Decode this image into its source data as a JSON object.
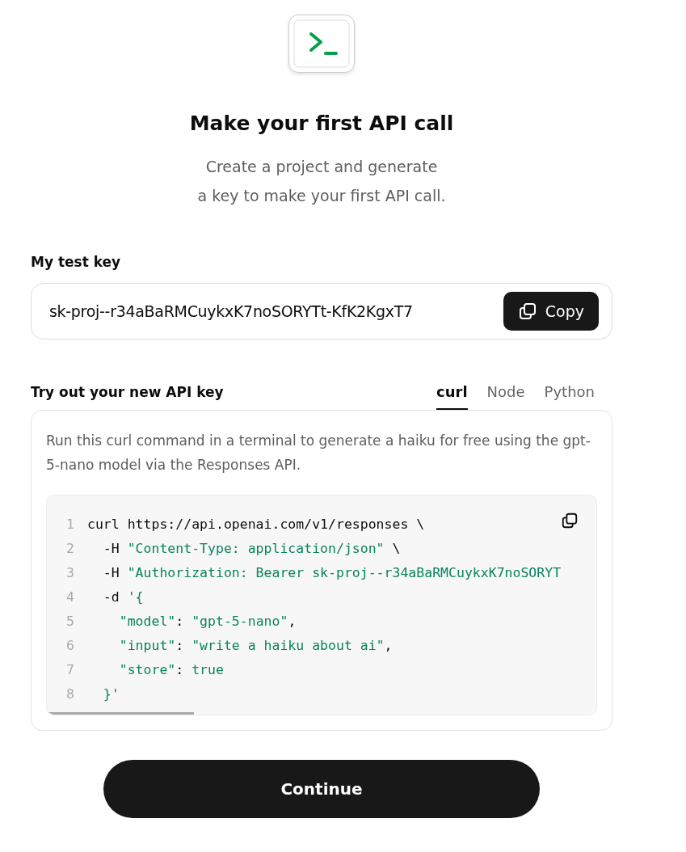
{
  "header": {
    "title": "Make your first API call",
    "subtitle_lines": [
      "Create a project and generate",
      "a key to make your first API call."
    ]
  },
  "key": {
    "label": "My test key",
    "value": "sk-proj--r34aBaRMCuykxK7noSORYTt-KfK2KgxT7",
    "copy_label": "Copy"
  },
  "try": {
    "label": "Try out your new API key",
    "tabs": [
      {
        "label": "curl",
        "selected": true
      },
      {
        "label": "Node",
        "selected": false
      },
      {
        "label": "Python",
        "selected": false
      }
    ],
    "description": "Run this curl command in a terminal to generate a haiku for free using the gpt-5-nano model via the Responses API.",
    "code": [
      {
        "number": "1",
        "tokens": [
          {
            "kind": "plain",
            "text": "curl https://api.openai.com/v1/responses \\"
          }
        ]
      },
      {
        "number": "2",
        "tokens": [
          {
            "kind": "plain",
            "text": "  -H "
          },
          {
            "kind": "string",
            "text": "\"Content-Type: application/json\""
          },
          {
            "kind": "plain",
            "text": " \\"
          }
        ]
      },
      {
        "number": "3",
        "tokens": [
          {
            "kind": "plain",
            "text": "  -H "
          },
          {
            "kind": "string",
            "text": "\"Authorization: Bearer sk-proj--r34aBaRMCuykxK7noSORYT"
          }
        ]
      },
      {
        "number": "4",
        "tokens": [
          {
            "kind": "plain",
            "text": "  -d "
          },
          {
            "kind": "string",
            "text": "'{"
          }
        ]
      },
      {
        "number": "5",
        "tokens": [
          {
            "kind": "string",
            "text": "    \"model\""
          },
          {
            "kind": "plain",
            "text": ": "
          },
          {
            "kind": "string",
            "text": "\"gpt-5-nano\""
          },
          {
            "kind": "plain",
            "text": ","
          }
        ]
      },
      {
        "number": "6",
        "tokens": [
          {
            "kind": "string",
            "text": "    \"input\""
          },
          {
            "kind": "plain",
            "text": ": "
          },
          {
            "kind": "string",
            "text": "\"write a haiku about ai\""
          },
          {
            "kind": "plain",
            "text": ","
          }
        ]
      },
      {
        "number": "7",
        "tokens": [
          {
            "kind": "string",
            "text": "    \"store\""
          },
          {
            "kind": "plain",
            "text": ": "
          },
          {
            "kind": "string",
            "text": "true"
          }
        ]
      },
      {
        "number": "8",
        "tokens": [
          {
            "kind": "string",
            "text": "  }'"
          }
        ]
      }
    ]
  },
  "continue_label": "Continue"
}
